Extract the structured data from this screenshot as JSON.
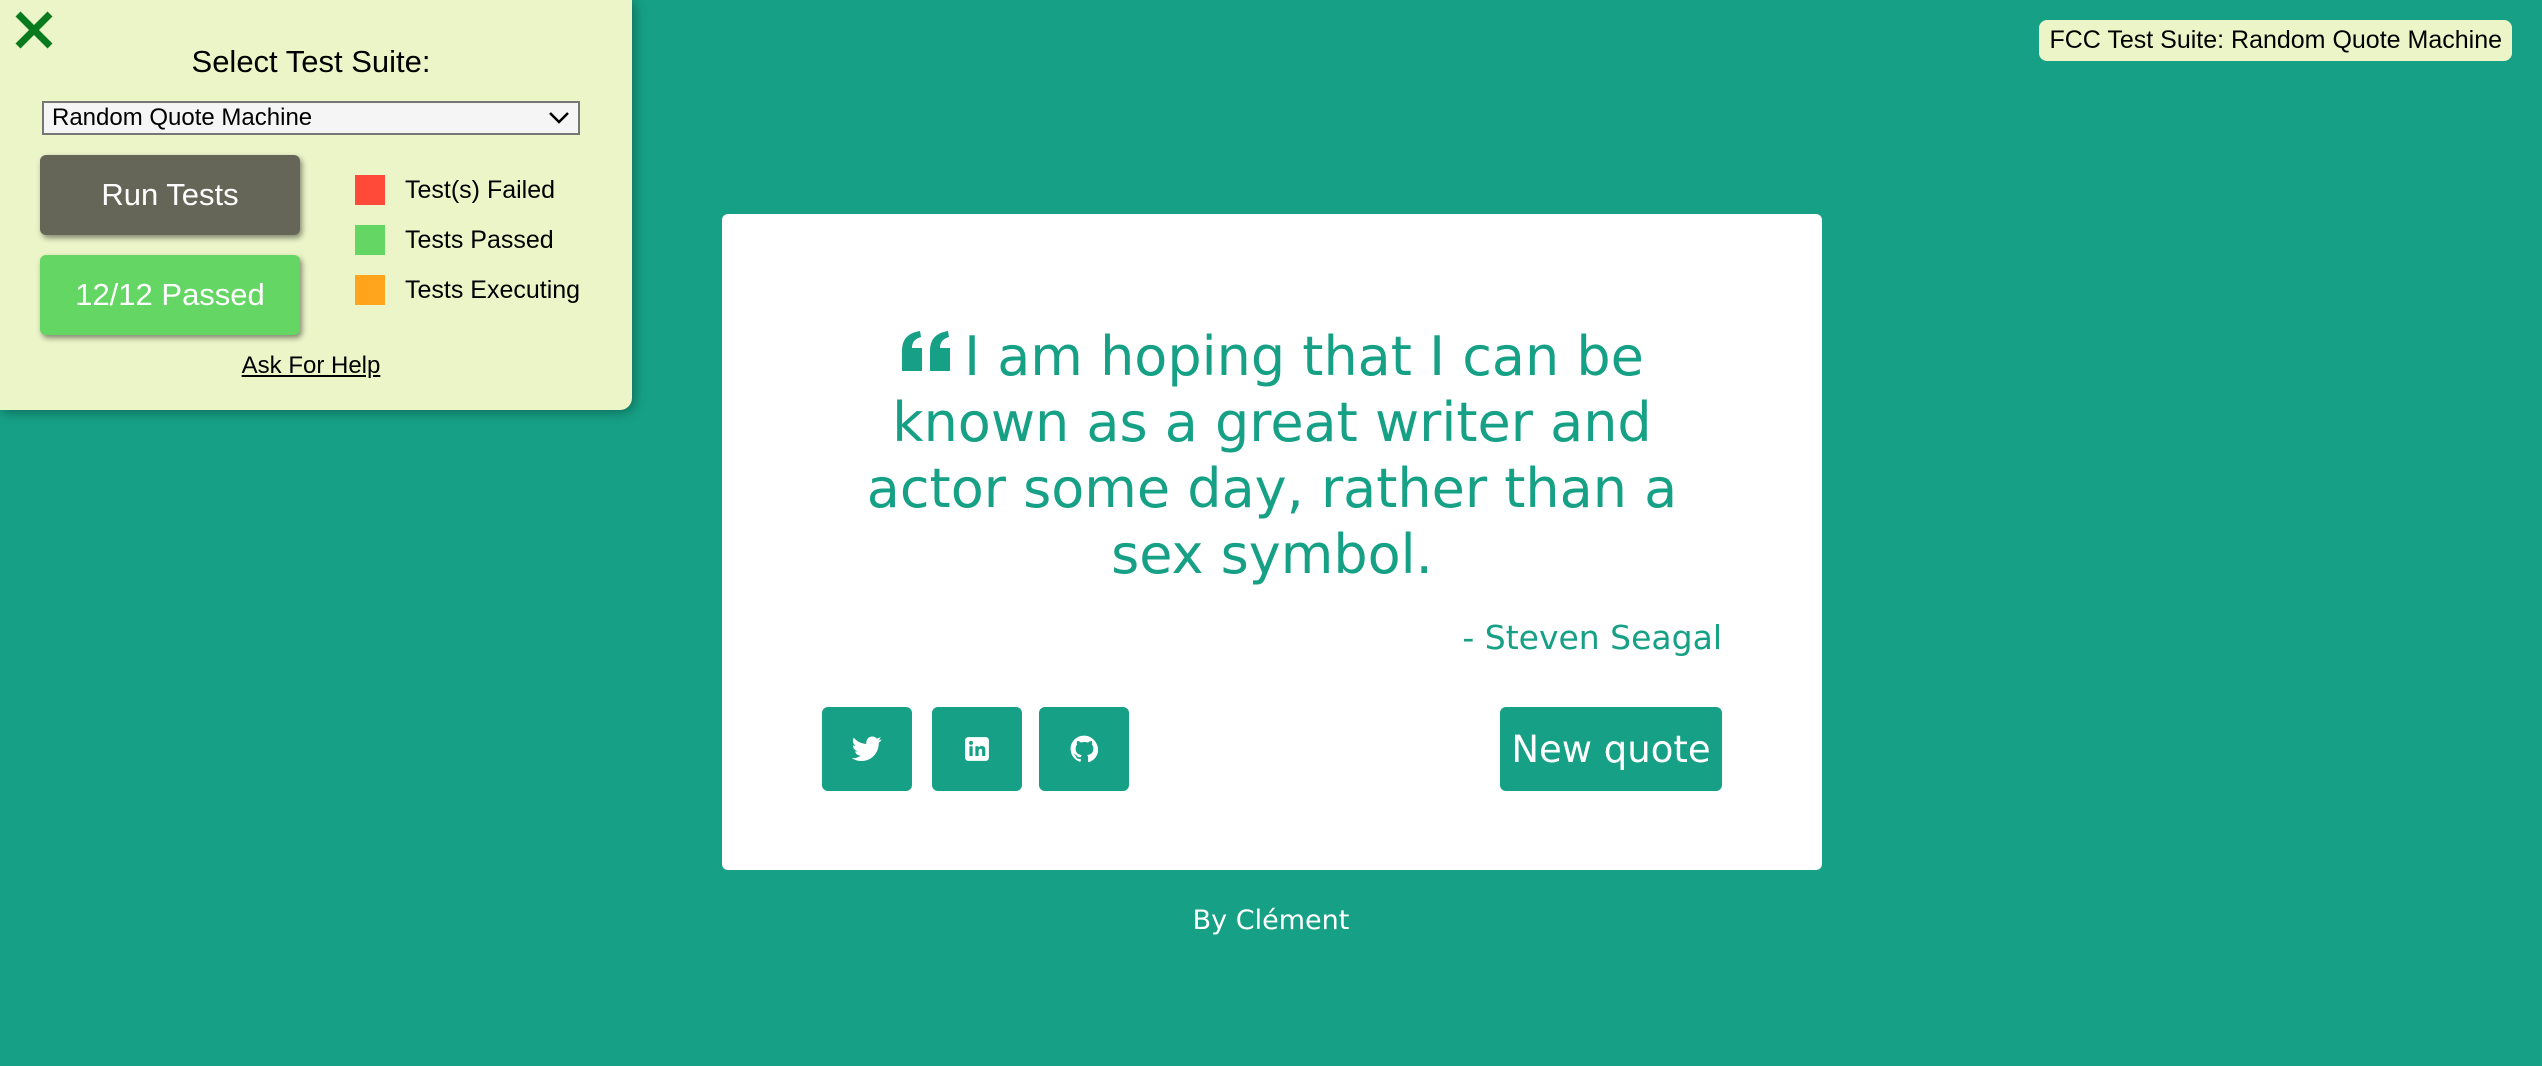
{
  "fcc_panel": {
    "close_icon": "close-x-icon",
    "title": "Select Test Suite:",
    "selected_suite": "Random Quote Machine",
    "run_button": "Run Tests",
    "result_button": "12/12 Passed",
    "legend": [
      {
        "label": "Test(s) Failed",
        "color": "#ff4a3a"
      },
      {
        "label": "Tests Passed",
        "color": "#64d664"
      },
      {
        "label": "Tests Executing",
        "color": "#ffa41c"
      }
    ],
    "help_link": "Ask For Help"
  },
  "fcc_label": "FCC Test Suite: Random Quote Machine",
  "quote": {
    "icon": "quote-left-icon",
    "text": "I am hoping that I can be known as a great writer and actor some day, rather than a sex symbol.",
    "author": "- Steven Seagal"
  },
  "actions": {
    "social": [
      "twitter-icon",
      "linkedin-icon",
      "github-icon"
    ],
    "new_quote": "New quote"
  },
  "footer": {
    "credit": "By Clément"
  },
  "colors": {
    "primary": "#16a085",
    "panel_bg": "#ebf5c8",
    "run_button": "#666658",
    "pass_button": "#64d664"
  }
}
